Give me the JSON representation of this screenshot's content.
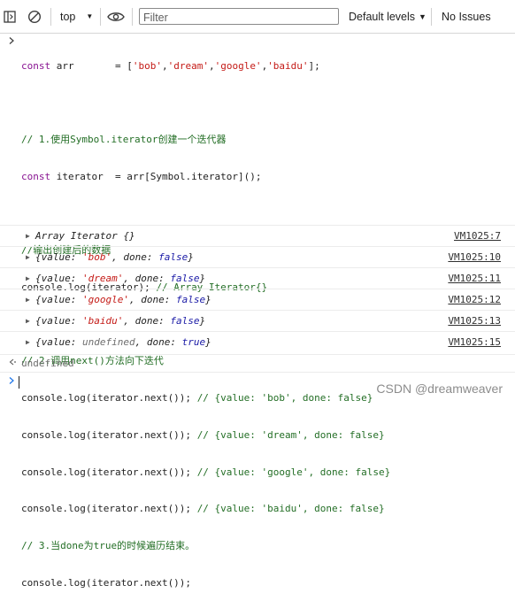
{
  "toolbar": {
    "context": "top",
    "filter_placeholder": "Filter",
    "levels_label": "Default levels",
    "issues_label": "No Issues",
    "dropdown_glyph": "▼"
  },
  "input_code": [
    "const arr       = ['bob','dream','google','baidu'];",
    "",
    "// 1.使用Symbol.iterator创建一个迭代器",
    "const iterator  = arr[Symbol.iterator]();",
    "",
    "//输出创建后的数据",
    "console.log(iterator); // Array Iterator{}",
    "",
    "// 2.调用next()方法向下迭代",
    "console.log(iterator.next()); // {value: 'bob', done: false}",
    "console.log(iterator.next()); // {value: 'dream', done: false}",
    "console.log(iterator.next()); // {value: 'google', done: false}",
    "console.log(iterator.next()); // {value: 'baidu', done: false}",
    "// 3.当done为true的时候遍历结束。",
    "console.log(iterator.next());"
  ],
  "outputs": [
    {
      "text": "Array Iterator {}",
      "source": "VM1025:7"
    },
    {
      "text": "{value: 'bob', done: false}",
      "key1": "value",
      "val1": "'bob'",
      "key2": "done",
      "val2": "false",
      "source": "VM1025:10"
    },
    {
      "text": "{value: 'dream', done: false}",
      "key1": "value",
      "val1": "'dream'",
      "key2": "done",
      "val2": "false",
      "source": "VM1025:11"
    },
    {
      "text": "{value: 'google', done: false}",
      "key1": "value",
      "val1": "'google'",
      "key2": "done",
      "val2": "false",
      "source": "VM1025:12"
    },
    {
      "text": "{value: 'baidu', done: false}",
      "key1": "value",
      "val1": "'baidu'",
      "key2": "done",
      "val2": "false",
      "source": "VM1025:13"
    },
    {
      "text": "{value: undefined, done: true}",
      "key1": "value",
      "val1": "undefined",
      "key2": "done",
      "val2": "true",
      "source": "VM1025:15"
    }
  ],
  "return_value": "undefined",
  "watermark": "CSDN @dreamweaver",
  "colors": {
    "comment": "#236e25",
    "keyword": "#881391",
    "string": "#c41a16",
    "boolean": "#1a1aa6",
    "prompt_blue": "#1a73e8"
  },
  "icons": [
    "sidebar-toggle-icon",
    "clear-console-icon",
    "eye-icon",
    "expand-triangle-icon",
    "prompt-arrow-icon",
    "return-arrow-icon"
  ]
}
